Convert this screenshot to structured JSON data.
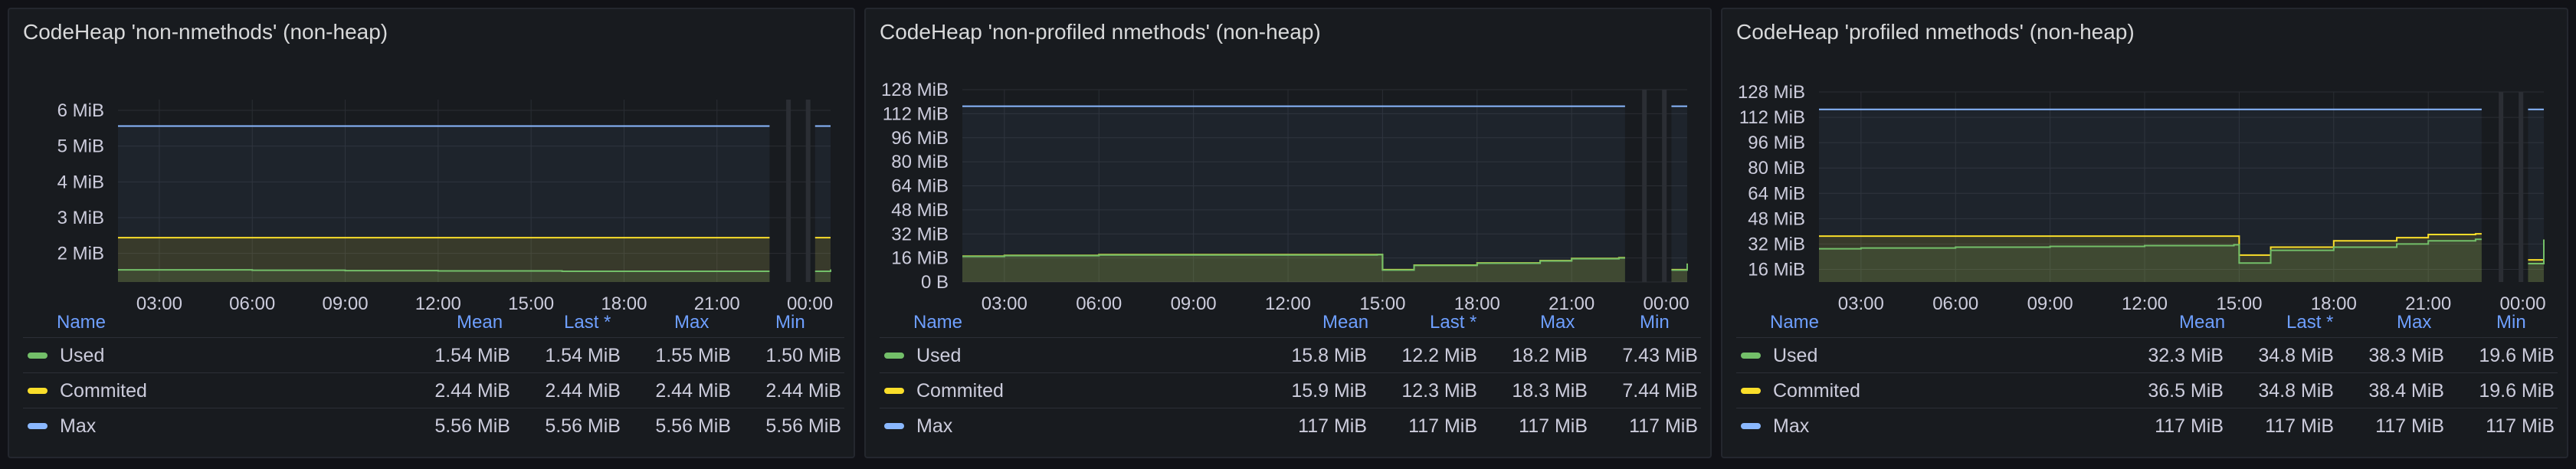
{
  "colors": {
    "used": "#73bf69",
    "commited": "#fade2a",
    "max": "#8ab8ff",
    "legend_header": "#6e9fff"
  },
  "legend_headers": {
    "name": "Name",
    "mean": "Mean",
    "last": "Last *",
    "max": "Max",
    "min": "Min"
  },
  "panels": [
    {
      "title": "CodeHeap 'non-nmethods' (non-heap)",
      "y_ticks": [
        "6 MiB",
        "5 MiB",
        "4 MiB",
        "3 MiB",
        "2 MiB"
      ],
      "x_ticks": [
        "03:00",
        "06:00",
        "09:00",
        "12:00",
        "15:00",
        "18:00",
        "21:00",
        "00:00"
      ],
      "legend": [
        {
          "name": "Used",
          "mean": "1.54 MiB",
          "last": "1.54 MiB",
          "max": "1.55 MiB",
          "min": "1.50 MiB"
        },
        {
          "name": "Commited",
          "mean": "2.44 MiB",
          "last": "2.44 MiB",
          "max": "2.44 MiB",
          "min": "2.44 MiB"
        },
        {
          "name": "Max",
          "mean": "5.56 MiB",
          "last": "5.56 MiB",
          "max": "5.56 MiB",
          "min": "5.56 MiB"
        }
      ]
    },
    {
      "title": "CodeHeap 'non-profiled nmethods' (non-heap)",
      "y_ticks": [
        "128 MiB",
        "112 MiB",
        "96 MiB",
        "80 MiB",
        "64 MiB",
        "48 MiB",
        "32 MiB",
        "16 MiB",
        "0 B"
      ],
      "x_ticks": [
        "03:00",
        "06:00",
        "09:00",
        "12:00",
        "15:00",
        "18:00",
        "21:00",
        "00:00"
      ],
      "legend": [
        {
          "name": "Used",
          "mean": "15.8 MiB",
          "last": "12.2 MiB",
          "max": "18.2 MiB",
          "min": "7.43 MiB"
        },
        {
          "name": "Commited",
          "mean": "15.9 MiB",
          "last": "12.3 MiB",
          "max": "18.3 MiB",
          "min": "7.44 MiB"
        },
        {
          "name": "Max",
          "mean": "117 MiB",
          "last": "117 MiB",
          "max": "117 MiB",
          "min": "117 MiB"
        }
      ]
    },
    {
      "title": "CodeHeap 'profiled nmethods' (non-heap)",
      "y_ticks": [
        "128 MiB",
        "112 MiB",
        "96 MiB",
        "80 MiB",
        "64 MiB",
        "48 MiB",
        "32 MiB",
        "16 MiB"
      ],
      "x_ticks": [
        "03:00",
        "06:00",
        "09:00",
        "12:00",
        "15:00",
        "18:00",
        "21:00",
        "00:00"
      ],
      "legend": [
        {
          "name": "Used",
          "mean": "32.3 MiB",
          "last": "34.8 MiB",
          "max": "38.3 MiB",
          "min": "19.6 MiB"
        },
        {
          "name": "Commited",
          "mean": "36.5 MiB",
          "last": "34.8 MiB",
          "max": "38.4 MiB",
          "min": "19.6 MiB"
        },
        {
          "name": "Max",
          "mean": "117 MiB",
          "last": "117 MiB",
          "max": "117 MiB",
          "min": "117 MiB"
        }
      ]
    }
  ],
  "chart_data": [
    {
      "type": "area",
      "title": "CodeHeap 'non-nmethods' (non-heap)",
      "unit": "MiB",
      "ylim": [
        1.2,
        6.3
      ],
      "x": [
        "01:40",
        "03:00",
        "06:00",
        "09:00",
        "12:00",
        "15:00",
        "16:00",
        "18:00",
        "21:00",
        "22:30",
        "23:20",
        "23:55",
        "00:10",
        "00:40"
      ],
      "series": [
        {
          "name": "Used",
          "values": [
            1.54,
            1.54,
            1.53,
            1.52,
            1.51,
            1.51,
            1.5,
            1.5,
            1.5,
            1.5,
            null,
            null,
            1.5,
            1.55
          ]
        },
        {
          "name": "Commited",
          "values": [
            2.44,
            2.44,
            2.44,
            2.44,
            2.44,
            2.44,
            2.44,
            2.44,
            2.44,
            2.44,
            null,
            null,
            2.44,
            2.44
          ]
        },
        {
          "name": "Max",
          "values": [
            5.56,
            5.56,
            5.56,
            5.56,
            5.56,
            5.56,
            5.56,
            5.56,
            5.56,
            5.56,
            null,
            null,
            5.56,
            5.56
          ]
        }
      ],
      "grid": true,
      "legend_placement": "bottom"
    },
    {
      "type": "area",
      "title": "CodeHeap 'non-profiled nmethods' (non-heap)",
      "unit": "MiB",
      "ylim": [
        0,
        128
      ],
      "x": [
        "01:40",
        "03:00",
        "06:00",
        "09:00",
        "12:00",
        "14:50",
        "15:00",
        "16:00",
        "18:00",
        "20:00",
        "21:00",
        "22:30",
        "23:20",
        "23:55",
        "00:10",
        "00:40"
      ],
      "series": [
        {
          "name": "Used",
          "values": [
            17,
            17.5,
            18,
            18,
            18,
            18.2,
            8,
            11,
            12.5,
            14,
            15.5,
            16,
            null,
            null,
            8,
            12.2
          ]
        },
        {
          "name": "Commited",
          "values": [
            17.2,
            17.7,
            18.2,
            18.2,
            18.2,
            18.3,
            8.2,
            11.2,
            12.7,
            14.2,
            15.7,
            16.2,
            null,
            null,
            8.2,
            12.3
          ]
        },
        {
          "name": "Max",
          "values": [
            117,
            117,
            117,
            117,
            117,
            117,
            117,
            117,
            117,
            117,
            117,
            117,
            null,
            null,
            117,
            117
          ]
        }
      ],
      "grid": true,
      "legend_placement": "bottom"
    },
    {
      "type": "area",
      "title": "CodeHeap 'profiled nmethods' (non-heap)",
      "unit": "MiB",
      "ylim": [
        8,
        128
      ],
      "x": [
        "01:40",
        "03:00",
        "06:00",
        "09:00",
        "12:00",
        "14:50",
        "15:00",
        "16:00",
        "18:00",
        "20:00",
        "21:00",
        "22:30",
        "23:20",
        "23:55",
        "00:10",
        "00:40"
      ],
      "series": [
        {
          "name": "Used",
          "values": [
            29,
            29.5,
            30,
            30.5,
            31,
            31.5,
            20,
            28,
            30,
            32,
            34,
            35,
            null,
            null,
            19.6,
            34.8
          ]
        },
        {
          "name": "Commited",
          "values": [
            37,
            37,
            37,
            37,
            37,
            37,
            25,
            30,
            34,
            36,
            38,
            38.4,
            null,
            null,
            22,
            34.8
          ]
        },
        {
          "name": "Max",
          "values": [
            117,
            117,
            117,
            117,
            117,
            117,
            117,
            117,
            117,
            117,
            117,
            117,
            null,
            null,
            117,
            117
          ]
        }
      ],
      "grid": true,
      "legend_placement": "bottom"
    }
  ]
}
